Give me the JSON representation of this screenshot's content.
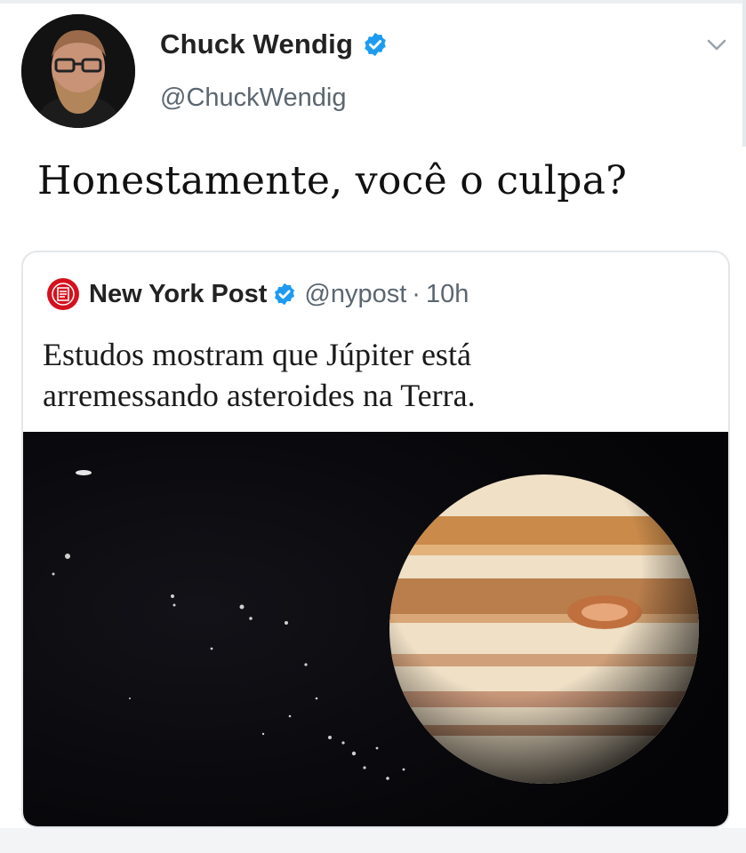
{
  "tweet": {
    "author_name": "Chuck Wendig",
    "author_handle": "@ChuckWendig",
    "text": "Honestamente, você o culpa?"
  },
  "quoted_tweet": {
    "author_name": "New York Post",
    "author_handle": "@nypost",
    "separator": "·",
    "time": "10h",
    "text_lines": [
      "Estudos mostram que Júpiter está",
      "arremessando asteroides na Terra."
    ],
    "logo_lettering": "NEW YORK POST"
  },
  "icons": {
    "avatar": "bearded-man-with-glasses-photo",
    "verified": "verified-badge-icon",
    "menu": "chevron-down-icon",
    "logo": "new-york-post-logo",
    "image": "jupiter-asteroids-photo"
  },
  "colors": {
    "verified_blue": "#1d9bf0",
    "text_primary": "#222222",
    "text_secondary": "#5b6670",
    "nypost_red": "#d4111e",
    "space_black": "#07070a"
  }
}
